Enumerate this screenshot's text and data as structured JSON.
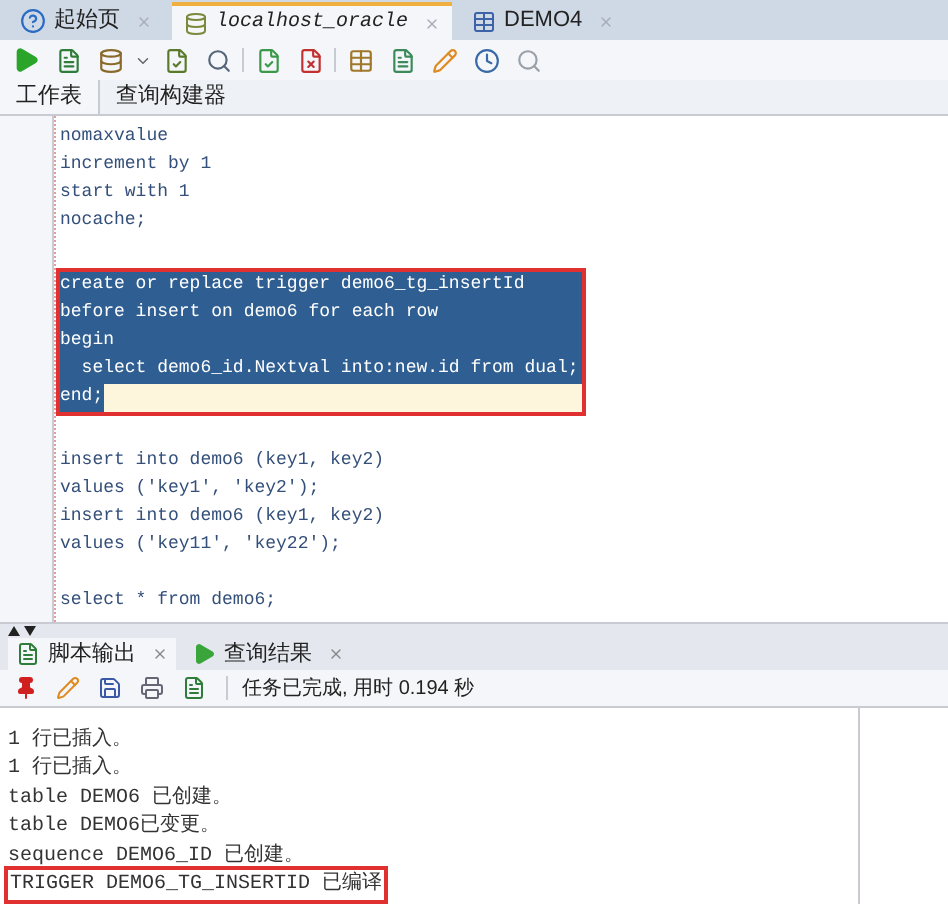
{
  "doc_tabs": [
    {
      "label": "起始页",
      "selected": false,
      "kind": "help",
      "italic": false
    },
    {
      "label": "localhost_oracle",
      "selected": true,
      "kind": "database",
      "italic": true
    },
    {
      "label": "DEMO4",
      "selected": false,
      "kind": "table",
      "italic": false
    }
  ],
  "worksheet_tabs": [
    {
      "label": "工作表",
      "selected": true
    },
    {
      "label": "查询构建器",
      "selected": false
    }
  ],
  "editor": {
    "blocks": [
      {
        "boxed": false,
        "lines": [
          {
            "text": "nomaxvalue",
            "selected": false,
            "current": false
          },
          {
            "text": "increment by 1",
            "selected": false,
            "current": false
          },
          {
            "text": "start with 1",
            "selected": false,
            "current": false
          },
          {
            "text": "nocache;",
            "selected": false,
            "current": false
          },
          {
            "selected": false,
            "current": false
          }
        ]
      },
      {
        "boxed": true,
        "lines": [
          {
            "text": "create or replace trigger demo6_tg_insertId",
            "selected": true,
            "current": false
          },
          {
            "text": "before insert on demo6 for each row",
            "selected": true,
            "current": false
          },
          {
            "text": "begin",
            "selected": true,
            "current": false
          },
          {
            "text": "  select demo6_id.Nextval into:new.id from dual;",
            "selected": true,
            "current": false
          },
          {
            "text": "end;",
            "selected": true,
            "current": true
          }
        ]
      },
      {
        "boxed": false,
        "lines": [
          {
            "selected": false,
            "current": false
          },
          {
            "text": "insert into demo6 (key1, key2)",
            "selected": false,
            "current": false
          },
          {
            "text": "values ('key1', 'key2');",
            "selected": false,
            "current": false
          },
          {
            "text": "insert into demo6 (key1, key2)",
            "selected": false,
            "current": false
          },
          {
            "text": "values ('key11', 'key22');",
            "selected": false,
            "current": false
          },
          {
            "selected": false,
            "current": false
          },
          {
            "text": "select * from demo6;",
            "selected": false,
            "current": false
          }
        ]
      }
    ]
  },
  "output_tabs": [
    {
      "label": "脚本输出",
      "selected": true,
      "kind": "script"
    },
    {
      "label": "查询结果",
      "selected": false,
      "kind": "run"
    }
  ],
  "output_status": "任务已完成, 用时 0.194 秒",
  "output_lines": [
    {
      "text": "1 行已插入。",
      "boxed": false
    },
    {
      "text": "1 行已插入。",
      "boxed": false
    },
    {
      "text": "table DEMO6 已创建。",
      "boxed": false
    },
    {
      "text": "table DEMO6已变更。",
      "boxed": false
    },
    {
      "text": "sequence DEMO6_ID 已创建。",
      "boxed": false
    },
    {
      "text": "TRIGGER DEMO6_TG_INSERTID 已编译",
      "boxed": true
    }
  ]
}
